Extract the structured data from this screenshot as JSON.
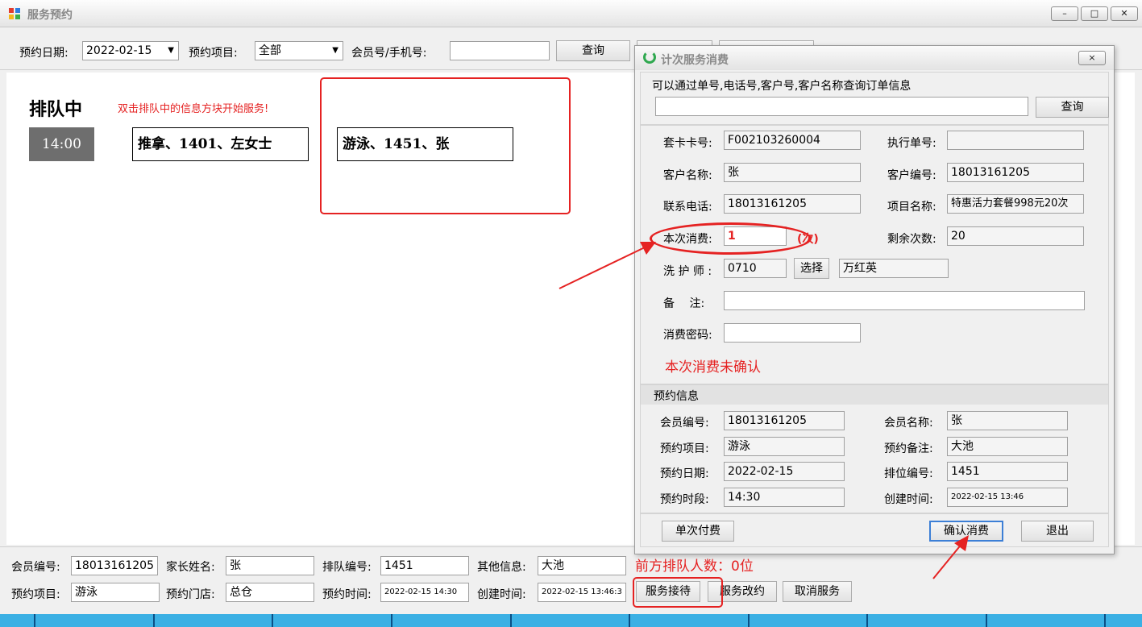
{
  "main": {
    "title": "服务预约",
    "toolbar": {
      "date_label": "预约日期:",
      "date_value": "2022-02-15",
      "project_label": "预约项目:",
      "project_value": "全部",
      "member_label": "会员号/手机号:",
      "member_value": "",
      "query_label": "查询"
    },
    "queue": {
      "heading": "排队中",
      "hint": "双击排队中的信息方块开始服务!",
      "time_slot": "14:00",
      "cards": [
        "推拿、1401、左女士",
        "游泳、1451、张"
      ]
    },
    "bottom": {
      "member_no_label": "会员编号:",
      "member_no": "18013161205",
      "parent_name_label": "家长姓名:",
      "parent_name": "张",
      "queue_no_label": "排队编号:",
      "queue_no": "1451",
      "other_label": "其他信息:",
      "other": "大池",
      "ahead_text": "前方排队人数：0位",
      "project_label": "预约项目:",
      "project": "游泳",
      "store_label": "预约门店:",
      "store": "总仓",
      "time_label": "预约时间:",
      "time": "2022-02-15 14:30",
      "created_label": "创建时间:",
      "created": "2022-02-15 13:46:3",
      "buttons": [
        "服务接待",
        "服务改约",
        "取消服务"
      ]
    }
  },
  "dialog": {
    "title": "计次服务消费",
    "close": "×",
    "search_hint": "可以通过单号,电话号,客户号,客户名称查询订单信息",
    "search_value": "",
    "query_label": "查询",
    "fields": {
      "card_no_label": "套卡卡号:",
      "card_no": "F002103260004",
      "exec_no_label": "执行单号:",
      "exec_no": "",
      "cust_name_label": "客户名称:",
      "cust_name": "张",
      "cust_no_label": "客户编号:",
      "cust_no": "18013161205",
      "phone_label": "联系电话:",
      "phone": "18013161205",
      "item_label": "项目名称:",
      "item": "特惠活力套餐998元20次",
      "consume_label": "本次消费:",
      "consume": "1",
      "consume_unit": "(次)",
      "remain_label": "剩余次数:",
      "remain": "20",
      "washer_label": "洗 护 师 :",
      "washer_code": "0710",
      "select_label": "选择",
      "washer_name": "万红英",
      "note_label": "备　 注:",
      "note": "",
      "pwd_label": "消费密码:",
      "pwd": "",
      "status": "本次消费未确认"
    },
    "booking": {
      "section_title": "预约信息",
      "member_no_label": "会员编号:",
      "member_no": "18013161205",
      "member_name_label": "会员名称:",
      "member_name": "张",
      "project_label": "预约项目:",
      "project": "游泳",
      "remark_label": "预约备注:",
      "remark": "大池",
      "date_label": "预约日期:",
      "date": "2022-02-15",
      "rank_label": "排位编号:",
      "rank": "1451",
      "slot_label": "预约时段:",
      "slot": "14:30",
      "created_label": "创建时间:",
      "created": "2022-02-15 13:46"
    },
    "buttons": {
      "single_pay": "单次付费",
      "confirm": "确认消费",
      "exit": "退出"
    }
  },
  "colors": {
    "accent_red": "#e52222",
    "taskbar": "#3bb0e4"
  }
}
